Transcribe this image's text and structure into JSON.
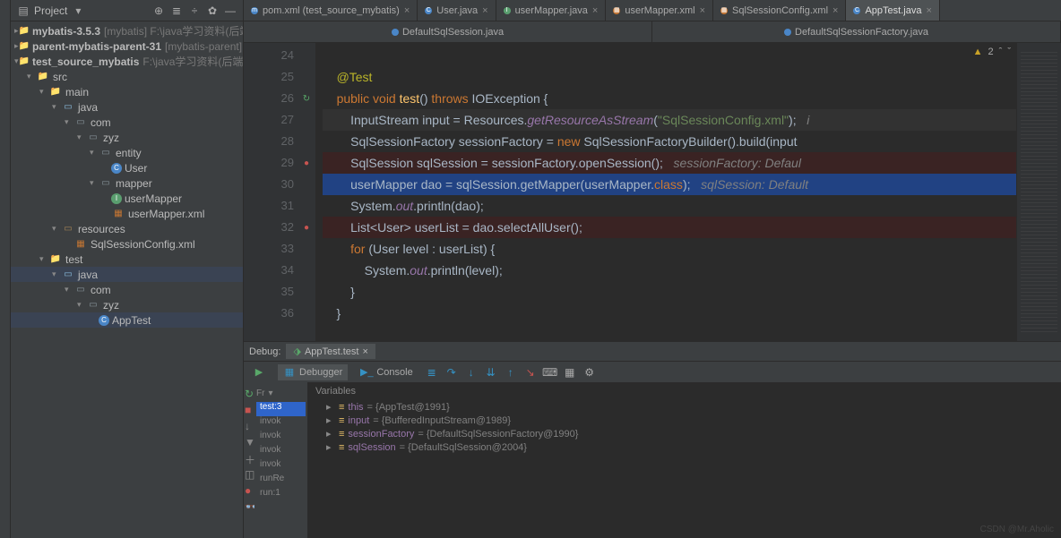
{
  "project_panel": {
    "title": "Project",
    "tree": [
      {
        "depth": 0,
        "arrow": "▸",
        "icon": "folder",
        "name": "mybatis-3.5.3",
        "extra": "[mybatis]  F:\\java学习资料(后端)\\源码",
        "bold": true
      },
      {
        "depth": 0,
        "arrow": "▸",
        "icon": "folder",
        "name": "parent-mybatis-parent-31",
        "extra": "[mybatis-parent]  F:\\ja",
        "bold": true
      },
      {
        "depth": 0,
        "arrow": "▾",
        "icon": "folder",
        "name": "test_source_mybatis",
        "extra": "F:\\java学习资料(后端)\\源码分",
        "bold": true
      },
      {
        "depth": 1,
        "arrow": "▾",
        "icon": "folder",
        "name": "src",
        "extra": ""
      },
      {
        "depth": 2,
        "arrow": "▾",
        "icon": "folder",
        "name": "main",
        "extra": ""
      },
      {
        "depth": 3,
        "arrow": "▾",
        "icon": "java",
        "name": "java",
        "extra": ""
      },
      {
        "depth": 4,
        "arrow": "▾",
        "icon": "pkg",
        "name": "com",
        "extra": ""
      },
      {
        "depth": 5,
        "arrow": "▾",
        "icon": "pkg",
        "name": "zyz",
        "extra": ""
      },
      {
        "depth": 6,
        "arrow": "▾",
        "icon": "pkg",
        "name": "entity",
        "extra": ""
      },
      {
        "depth": 7,
        "arrow": "",
        "icon": "cls",
        "name": "User",
        "extra": ""
      },
      {
        "depth": 6,
        "arrow": "▾",
        "icon": "pkg",
        "name": "mapper",
        "extra": ""
      },
      {
        "depth": 7,
        "arrow": "",
        "icon": "iface",
        "name": "userMapper",
        "extra": ""
      },
      {
        "depth": 7,
        "arrow": "",
        "icon": "xml",
        "name": "userMapper.xml",
        "extra": ""
      },
      {
        "depth": 3,
        "arrow": "▾",
        "icon": "res",
        "name": "resources",
        "extra": ""
      },
      {
        "depth": 4,
        "arrow": "",
        "icon": "xml",
        "name": "SqlSessionConfig.xml",
        "extra": ""
      },
      {
        "depth": 2,
        "arrow": "▾",
        "icon": "folder",
        "name": "test",
        "extra": ""
      },
      {
        "depth": 3,
        "arrow": "▾",
        "icon": "java",
        "name": "java",
        "extra": "",
        "sel": true
      },
      {
        "depth": 4,
        "arrow": "▾",
        "icon": "pkg",
        "name": "com",
        "extra": ""
      },
      {
        "depth": 5,
        "arrow": "▾",
        "icon": "pkg",
        "name": "zyz",
        "extra": ""
      },
      {
        "depth": 6,
        "arrow": "",
        "icon": "cls",
        "name": "AppTest",
        "extra": "",
        "sel": true
      }
    ]
  },
  "tabs": [
    {
      "icon": "#4a86c7",
      "label": "pom.xml (test_source_mybatis)",
      "letter": "m"
    },
    {
      "icon": "#4a86c7",
      "label": "User.java",
      "letter": "C"
    },
    {
      "icon": "#5a9e6f",
      "label": "userMapper.java",
      "letter": "I"
    },
    {
      "icon": "#c57633",
      "label": "userMapper.xml",
      "letter": "▦"
    },
    {
      "icon": "#c57633",
      "label": "SqlSessionConfig.xml",
      "letter": "▦"
    },
    {
      "icon": "#4a86c7",
      "label": "AppTest.java",
      "letter": "C",
      "active": true
    }
  ],
  "subtabs": [
    {
      "label": "DefaultSqlSession.java"
    },
    {
      "label": "DefaultSqlSessionFactory.java"
    }
  ],
  "warning": {
    "count": "2"
  },
  "lines": {
    "start": 24,
    "rows": [
      {
        "n": 24,
        "html": ""
      },
      {
        "n": 25,
        "html": "    <span class='ann'>@Test</span>"
      },
      {
        "n": 26,
        "html": "    <span class='kw'>public void</span> <span class='mtd'>test</span>() <span class='kw'>throws</span> IOException {",
        "gut": "↻"
      },
      {
        "n": 27,
        "html": "        InputStream input = Resources.<span class='fld'>getResourceAsStream</span>(<span class='str'>\"SqlSessionConfig.xml\"</span>);   <span class='cmt'>i</span>",
        "hl": true
      },
      {
        "n": 28,
        "html": "        SqlSessionFactory sessionFactory = <span class='kw'>new</span> SqlSessionFactoryBuilder().build(input"
      },
      {
        "n": 29,
        "html": "        SqlSession sqlSession = sessionFactory.openSession();   <span class='cmt'>sessionFactory: Defaul</span>",
        "bp": true,
        "gut": "●"
      },
      {
        "n": 30,
        "html": "        userMapper dao = sqlSession.getMapper(userMapper.<span class='kw'>class</span>);   <span class='cmt'>sqlSession: Default</span>",
        "sel": true
      },
      {
        "n": 31,
        "html": "        System.<span class='fld'>out</span>.println(dao);"
      },
      {
        "n": 32,
        "html": "        List&lt;User&gt; userList = dao.selectAllUser();",
        "bp": true,
        "gut": "●"
      },
      {
        "n": 33,
        "html": "        <span class='kw'>for</span> (User level : userList) {"
      },
      {
        "n": 34,
        "html": "            System.<span class='fld'>out</span>.println(level);"
      },
      {
        "n": 35,
        "html": "        }"
      },
      {
        "n": 36,
        "html": "    }"
      }
    ]
  },
  "debug": {
    "title": "Debug:",
    "tab": "AppTest.test",
    "debugger": "Debugger",
    "console": "Console",
    "vars_label": "Variables",
    "frames_label": "Fr",
    "stack": [
      "test:3",
      "invok",
      "invok",
      "invok",
      "invok",
      "runRe",
      "run:1"
    ],
    "vars": [
      {
        "name": "this",
        "val": "{AppTest@1991}"
      },
      {
        "name": "input",
        "val": "{BufferedInputStream@1989}"
      },
      {
        "name": "sessionFactory",
        "val": "{DefaultSqlSessionFactory@1990}"
      },
      {
        "name": "sqlSession",
        "val": "{DefaultSqlSession@2004}"
      }
    ]
  },
  "watermark": "CSDN @Mr.Aholic"
}
